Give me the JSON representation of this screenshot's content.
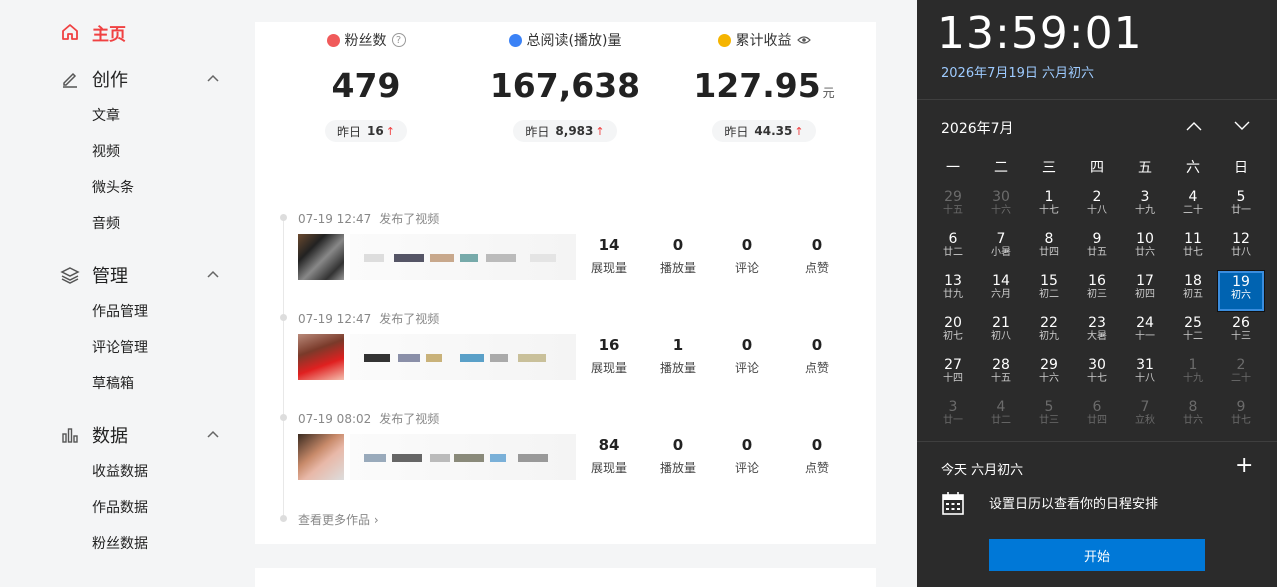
{
  "sidebar": {
    "home": "主页",
    "groups": [
      {
        "title": "创作",
        "items": [
          "文章",
          "视频",
          "微头条",
          "音频"
        ]
      },
      {
        "title": "管理",
        "items": [
          "作品管理",
          "评论管理",
          "草稿箱"
        ]
      },
      {
        "title": "数据",
        "items": [
          "收益数据",
          "作品数据",
          "粉丝数据"
        ]
      }
    ]
  },
  "stats": [
    {
      "label": "粉丝数",
      "value": "479",
      "unit": "",
      "yest_label": "昨日",
      "yest_value": "16",
      "color": "#f05a5a"
    },
    {
      "label": "总阅读(播放)量",
      "value": "167,638",
      "unit": "",
      "yest_label": "昨日",
      "yest_value": "8,983",
      "color": "#3b82f6"
    },
    {
      "label": "累计收益",
      "value": "127.95",
      "unit": "元",
      "yest_label": "昨日",
      "yest_value": "44.35",
      "color": "#f5b400"
    }
  ],
  "posts": [
    {
      "time": "07-19 12:47",
      "action": "发布了视频",
      "metrics": [
        {
          "n": "14",
          "l": "展现量"
        },
        {
          "n": "0",
          "l": "播放量"
        },
        {
          "n": "0",
          "l": "评论"
        },
        {
          "n": "0",
          "l": "点赞"
        }
      ]
    },
    {
      "time": "07-19 12:47",
      "action": "发布了视频",
      "metrics": [
        {
          "n": "16",
          "l": "展现量"
        },
        {
          "n": "1",
          "l": "播放量"
        },
        {
          "n": "0",
          "l": "评论"
        },
        {
          "n": "0",
          "l": "点赞"
        }
      ]
    },
    {
      "time": "07-19 08:02",
      "action": "发布了视频",
      "metrics": [
        {
          "n": "84",
          "l": "展现量"
        },
        {
          "n": "0",
          "l": "播放量"
        },
        {
          "n": "0",
          "l": "评论"
        },
        {
          "n": "0",
          "l": "点赞"
        }
      ]
    }
  ],
  "more_link": "查看更多作品",
  "calendar": {
    "time": "13:59:01",
    "full_date": "2026年7月19日 六月初六",
    "month_label": "2026年7月",
    "weekdays": [
      "一",
      "二",
      "三",
      "四",
      "五",
      "六",
      "日"
    ],
    "days": [
      {
        "d": "29",
        "l": "十五",
        "out": true
      },
      {
        "d": "30",
        "l": "十六",
        "out": true
      },
      {
        "d": "1",
        "l": "十七"
      },
      {
        "d": "2",
        "l": "十八"
      },
      {
        "d": "3",
        "l": "十九"
      },
      {
        "d": "4",
        "l": "二十"
      },
      {
        "d": "5",
        "l": "廿一"
      },
      {
        "d": "6",
        "l": "廿二"
      },
      {
        "d": "7",
        "l": "小暑"
      },
      {
        "d": "8",
        "l": "廿四"
      },
      {
        "d": "9",
        "l": "廿五"
      },
      {
        "d": "10",
        "l": "廿六"
      },
      {
        "d": "11",
        "l": "廿七"
      },
      {
        "d": "12",
        "l": "廿八"
      },
      {
        "d": "13",
        "l": "廿九"
      },
      {
        "d": "14",
        "l": "六月"
      },
      {
        "d": "15",
        "l": "初二"
      },
      {
        "d": "16",
        "l": "初三"
      },
      {
        "d": "17",
        "l": "初四"
      },
      {
        "d": "18",
        "l": "初五"
      },
      {
        "d": "19",
        "l": "初六",
        "today": true
      },
      {
        "d": "20",
        "l": "初七"
      },
      {
        "d": "21",
        "l": "初八"
      },
      {
        "d": "22",
        "l": "初九"
      },
      {
        "d": "23",
        "l": "大暑"
      },
      {
        "d": "24",
        "l": "十一"
      },
      {
        "d": "25",
        "l": "十二"
      },
      {
        "d": "26",
        "l": "十三"
      },
      {
        "d": "27",
        "l": "十四"
      },
      {
        "d": "28",
        "l": "十五"
      },
      {
        "d": "29",
        "l": "十六"
      },
      {
        "d": "30",
        "l": "十七"
      },
      {
        "d": "31",
        "l": "十八"
      },
      {
        "d": "1",
        "l": "十九",
        "out": true
      },
      {
        "d": "2",
        "l": "二十",
        "out": true
      },
      {
        "d": "3",
        "l": "廿一",
        "out": true
      },
      {
        "d": "4",
        "l": "廿二",
        "out": true
      },
      {
        "d": "5",
        "l": "廿三",
        "out": true
      },
      {
        "d": "6",
        "l": "廿四",
        "out": true
      },
      {
        "d": "7",
        "l": "立秋",
        "out": true
      },
      {
        "d": "8",
        "l": "廿六",
        "out": true
      },
      {
        "d": "9",
        "l": "廿七",
        "out": true
      }
    ],
    "today_text": "今天 六月初六",
    "setup_text": "设置日历以查看你的日程安排",
    "start_label": "开始"
  }
}
